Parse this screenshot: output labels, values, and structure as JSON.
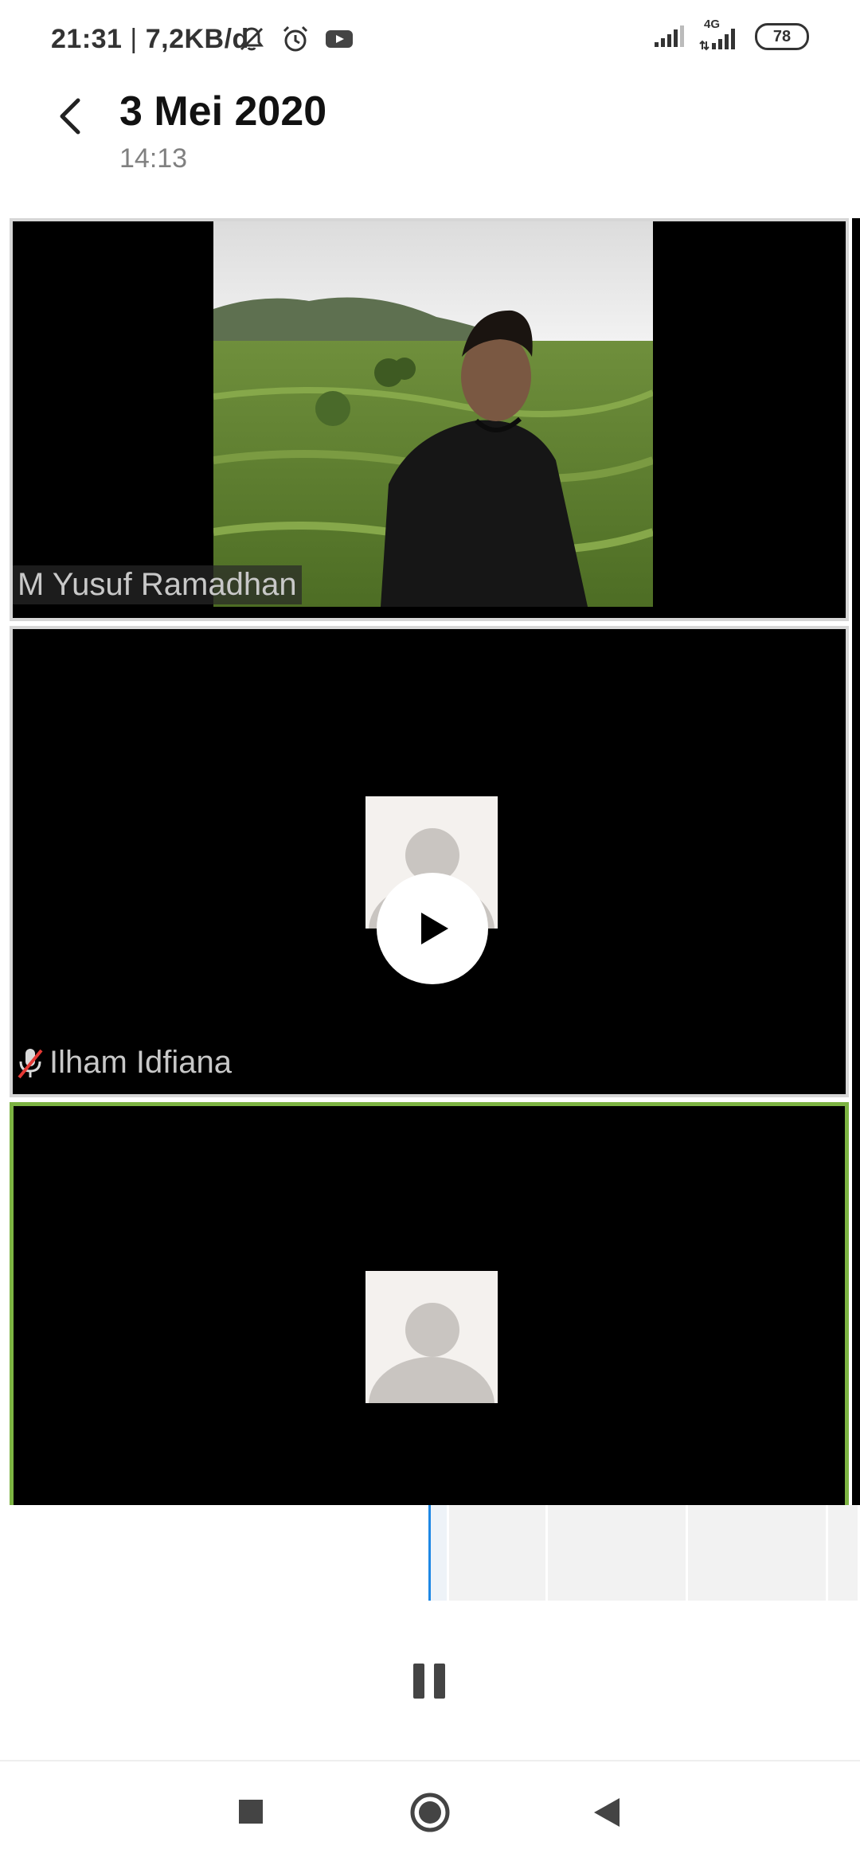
{
  "status_bar": {
    "time": "21:31",
    "separator": "|",
    "data_rate": "7,2KB/d",
    "network": "4G",
    "battery": "78",
    "icons": [
      "notifications-muted-icon",
      "alarm-icon",
      "youtube-icon",
      "signal-icon",
      "signal-4g-icon",
      "battery-icon"
    ]
  },
  "header": {
    "title": "3 Mei 2020",
    "subtitle": "14:13",
    "back_icon": "back-arrow-icon"
  },
  "participants": [
    {
      "name": "M Yusuf Ramadhan",
      "has_video": true,
      "muted": false
    },
    {
      "name": "Ilham Idfiana",
      "has_video": false,
      "muted": true
    },
    {
      "name": "",
      "has_video": false,
      "muted": false,
      "active_speaker": true
    }
  ],
  "player": {
    "play_icon": "play-icon",
    "pause_icon": "pause-icon"
  },
  "nav": {
    "icons": [
      "recents-square-icon",
      "home-circle-icon",
      "back-triangle-icon"
    ]
  },
  "colors": {
    "active_border": "#7cb342",
    "playhead": "#1e88e5",
    "tile_border": "#d6d6d6"
  }
}
